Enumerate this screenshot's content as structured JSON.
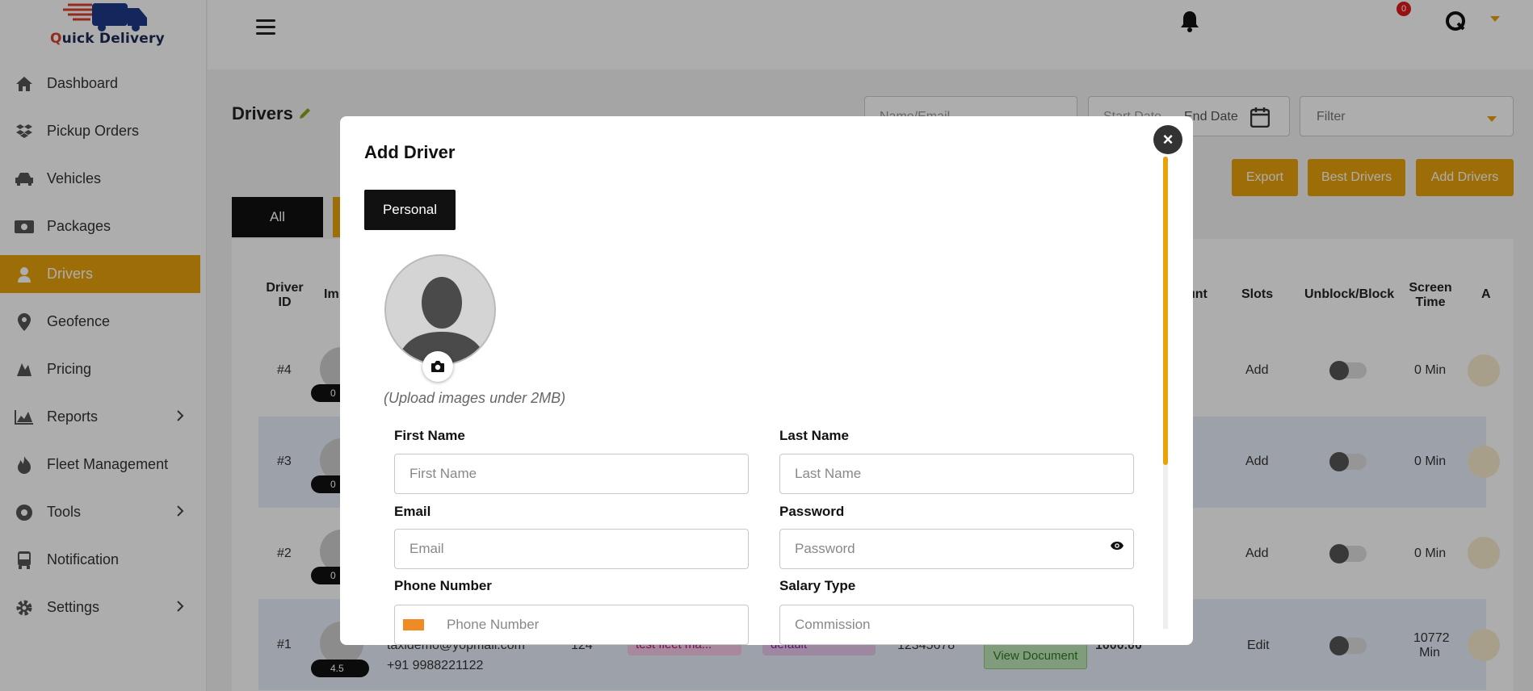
{
  "app": {
    "logo_text_q": "Q",
    "logo_text_rest": "uick Delivery"
  },
  "sidebar": {
    "items": [
      {
        "label": "Dashboard",
        "icon": "home-icon"
      },
      {
        "label": "Pickup Orders",
        "icon": "dropbox-icon"
      },
      {
        "label": "Vehicles",
        "icon": "car-icon"
      },
      {
        "label": "Packages",
        "icon": "money-icon"
      },
      {
        "label": "Drivers",
        "icon": "driver-icon",
        "active": true
      },
      {
        "label": "Geofence",
        "icon": "map-pin-icon"
      },
      {
        "label": "Pricing",
        "icon": "pricing-icon"
      },
      {
        "label": "Reports",
        "icon": "chart-area-icon",
        "has_submenu": true
      },
      {
        "label": "Fleet Management",
        "icon": "fire-icon"
      },
      {
        "label": "Tools",
        "icon": "tools-icon",
        "has_submenu": true
      },
      {
        "label": "Notification",
        "icon": "bus-icon"
      },
      {
        "label": "Settings",
        "icon": "gear-icon",
        "has_submenu": true
      }
    ]
  },
  "topbar": {
    "notification_count": "0"
  },
  "page": {
    "title": "Drivers",
    "search_placeholder": "Name/Email",
    "start_date": "Start Date",
    "end_date": "End Date",
    "filter_label": "Filter",
    "buttons": {
      "export": "Export",
      "best": "Best Drivers",
      "add": "Add Drivers"
    },
    "tabs": {
      "all": "All"
    }
  },
  "table": {
    "headers": {
      "driver_id": "Driver ID",
      "image": "Im",
      "amount": "unt",
      "slots": "Slots",
      "block": "Unblock/Block",
      "screen_time": "Screen Time",
      "action": "A"
    },
    "rows": [
      {
        "id": "#4",
        "rating": "0",
        "slots": "Add",
        "screen_time": "0 Min"
      },
      {
        "id": "#3",
        "rating": "0",
        "slots": "Add",
        "screen_time": "0 Min"
      },
      {
        "id": "#2",
        "rating": "0",
        "slots": "Add",
        "screen_time": "0 Min"
      },
      {
        "id": "#1",
        "rating": "4.5",
        "email": "taxidemo@yopmail.com",
        "phone": "+91 9988221122",
        "vehicles": "124",
        "fleet": "test fleet ma...",
        "pricing": "default",
        "license": "12345678",
        "document": "View Document",
        "amount": "1000.00",
        "slots": "Edit",
        "screen_time": "10772 Min"
      }
    ]
  },
  "modal": {
    "title": "Add Driver",
    "tab": "Personal",
    "upload_note": "(Upload images under 2MB)",
    "fields": {
      "first_name": {
        "label": "First Name",
        "placeholder": "First Name"
      },
      "last_name": {
        "label": "Last Name",
        "placeholder": "Last Name"
      },
      "email": {
        "label": "Email",
        "placeholder": "Email"
      },
      "password": {
        "label": "Password",
        "placeholder": "Password"
      },
      "phone": {
        "label": "Phone Number",
        "placeholder": "Phone Number"
      },
      "salary": {
        "label": "Salary Type",
        "placeholder": "Commission"
      }
    },
    "close": "×"
  }
}
